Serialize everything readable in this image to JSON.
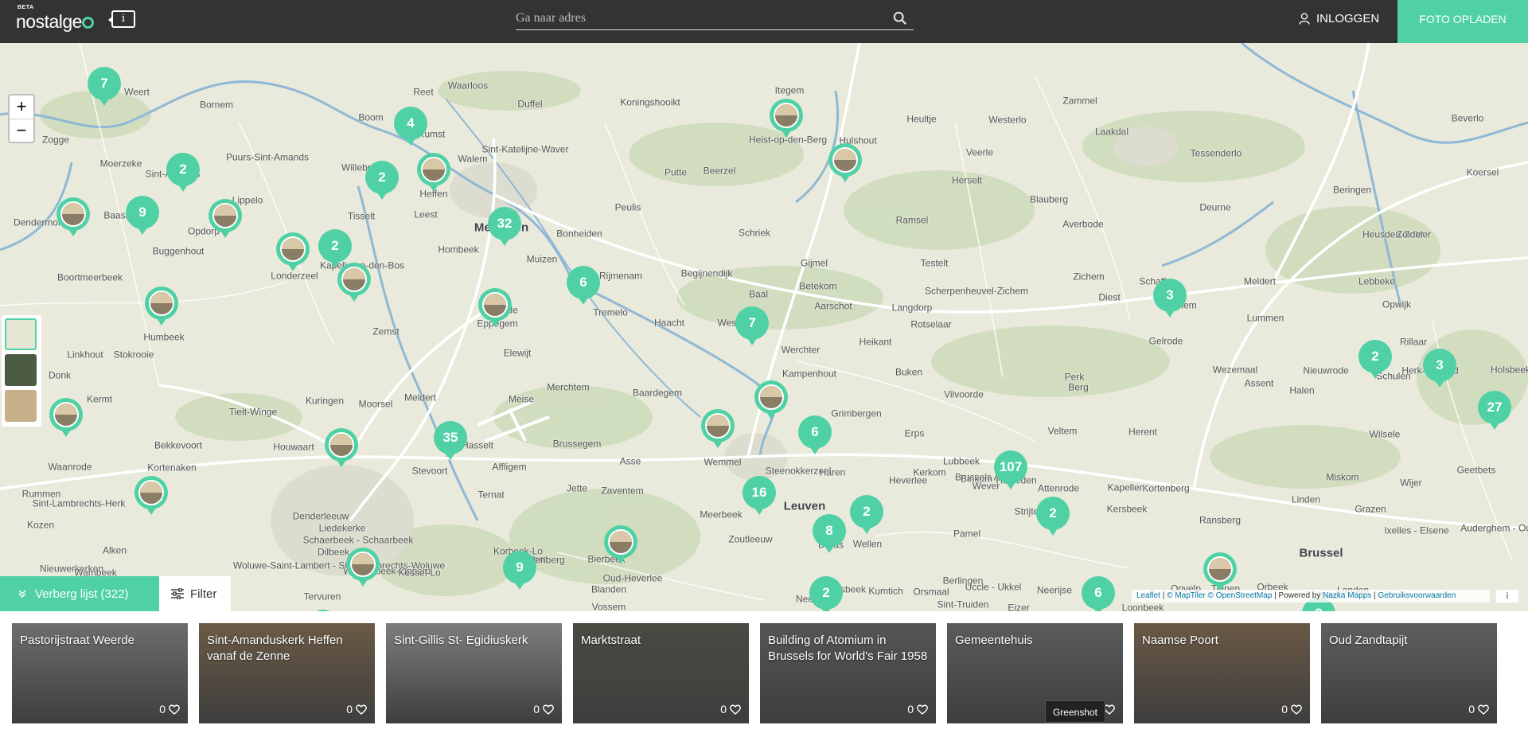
{
  "header": {
    "logo_beta": "BETA",
    "logo_text": "nostalge",
    "info_icon": "info-icon",
    "search_placeholder": "Ga naar adres",
    "login_label": "INLOGGEN",
    "upload_label": "FOTO OPLADEN"
  },
  "map": {
    "zoom_in": "+",
    "zoom_out": "−",
    "places": [
      "Weert",
      "Bornem",
      "Reet",
      "Waarloos",
      "Duffel",
      "Koningshooikt",
      "Itegem",
      "Zammel",
      "Beverlo",
      "Zogge",
      "Puurs-Sint-Amands",
      "Boom",
      "Rumst",
      "Sint-Katelijne-Waver",
      "Heist-op-den-Berg",
      "Hulshout",
      "Heultje",
      "Westerlo",
      "Laakdal",
      "Tessenderlo",
      "Moerzeke",
      "Sint-Amands",
      "Willebroek",
      "Walem",
      "Putte",
      "Beerzel",
      "Veerle",
      "Koersel",
      "Lippelo",
      "Heffen",
      "Herselt",
      "Blauberg",
      "Deurne",
      "Beringen",
      "Dendermonde",
      "Baasrode",
      "Opdorp",
      "Tisselt",
      "Leest",
      "Mechelen",
      "Bonheiden",
      "Peulis",
      "Schriek",
      "Ramsel",
      "Averbode",
      "Heusden-Zolder",
      "Zolder",
      "Buggenhout",
      "Londerzeel",
      "Kapelle-op-den-Bos",
      "Hombeek",
      "Muizen",
      "Rijmenam",
      "Begijnendijk",
      "Gijmel",
      "Testelt",
      "Zichem",
      "Schaffen",
      "Meldert",
      "Lebbeke",
      "Boortmeerbeek",
      "Tremelo",
      "Baal",
      "Betekom",
      "Aarschot",
      "Langdorp",
      "Scherpenheuvel-Zichem",
      "Diest",
      "Zelem",
      "Lummen",
      "Opwijk",
      "Humbeek",
      "Zemst",
      "Weerde",
      "Eppegem",
      "Elewijt",
      "Haacht",
      "Wespelaar",
      "Werchter",
      "Heikant",
      "Rotselaar",
      "Gelrode",
      "Rillaar",
      "Linkhout",
      "Stokrooie",
      "Merchtem",
      "Baardegem",
      "Kampenhout",
      "Buken",
      "Wezemaal",
      "Nieuwrode",
      "Assent",
      "Halen",
      "Schulen",
      "Herk-de-Stad",
      "Donk",
      "Kermt",
      "Kuringen",
      "Moorsel",
      "Meldert",
      "Meise",
      "Grimbergen",
      "Vilvoorde",
      "Perk",
      "Berg",
      "Holsbeek",
      "Tielt-Winge",
      "Bekkevoort",
      "Houwaart",
      "Hasselt",
      "Brussegem",
      "Asse",
      "Wemmel",
      "Steenokkerzeel",
      "Erps",
      "Veltem",
      "Herent",
      "Wilsele",
      "Waanrode",
      "Kortenaken",
      "Stevoort",
      "Affligem",
      "Haren",
      "Brussels Airport",
      "Kortenberg",
      "Linden",
      "Miskom",
      "Wijer",
      "Geetbets",
      "Rummen",
      "Sint-Lambrechts-Herk",
      "Denderleeuw",
      "Ternat",
      "Jette",
      "Zaventem",
      "Meerbeek",
      "Leuven",
      "Lubbeek",
      "Binkom",
      "Attenrode",
      "Kapellen",
      "Kersbeek",
      "Ransberg",
      "Grazen",
      "Kozen",
      "Alken",
      "Liedekerke",
      "Schaerbeek - Schaarbeek",
      "Bertem",
      "Heverlee",
      "Kerkom",
      "Wever",
      "Hoeleden",
      "Nieuwerkerken",
      "Wambeek",
      "Dilbeek",
      "Woluwe-Saint-Lambert - Sint-Lambrechts-Woluwe",
      "Wezembeek-Oppem",
      "Kessel-Lo",
      "Korbeek-Lo",
      "Pellenberg",
      "Bierbeek",
      "Zoutleeuw",
      "Duras",
      "Wellen",
      "Pamel",
      "Strijtem",
      "Brussel",
      "Ixelles - Elsene",
      "Auderghem - Oudergem",
      "Tervuren",
      "Vossem",
      "Oud-Heverlee",
      "Blanden",
      "Neervelp",
      "Roosbeek",
      "Kumtich",
      "Orsmaal",
      "Sint-Truiden",
      "Berlingen",
      "Uccle - Ukkel",
      "Eizer",
      "Neerijse",
      "Loonbeek",
      "Opvelp",
      "Tienen",
      "Orbeek",
      "Bilkel",
      "Landen"
    ],
    "cluster_counts": [
      "7",
      "4",
      "9",
      "2",
      "2",
      "2",
      "32",
      "6",
      "7",
      "3",
      "2",
      "3",
      "27",
      "35",
      "6",
      "107",
      "16",
      "2",
      "2",
      "8",
      "9",
      "2",
      "6",
      "2"
    ],
    "layer_options": [
      "street-map",
      "satellite",
      "historic-map"
    ],
    "list_toggle_label": "Verberg lijst (322)",
    "filter_label": "Filter",
    "attribution": {
      "leaflet": "Leaflet",
      "tiles": "© MapTiler © OpenStreetMap",
      "powered": "Powered by",
      "nazka": "Nazka Mapps",
      "terms": "Gebruiksvoorwaarden"
    },
    "attrib_info": "i"
  },
  "cards": [
    {
      "title": "Pastorijstraat Weerde",
      "likes": "0",
      "color": "#6d6d6d"
    },
    {
      "title": "Sint-Amanduskerk Heffen vanaf de Zenne",
      "likes": "0",
      "color": "#6b5a45"
    },
    {
      "title": "Sint-Gillis St- Egidiuskerk",
      "likes": "0",
      "color": "#7d7d7d"
    },
    {
      "title": "Marktstraat",
      "likes": "0",
      "color": "#4a4a42"
    },
    {
      "title": "Building of Atomium in Brussels for World's Fair 1958",
      "likes": "0",
      "color": "#555555"
    },
    {
      "title": "Gemeentehuis",
      "likes": "0",
      "color": "#5b5b5b"
    },
    {
      "title": "Naamse Poort",
      "likes": "0",
      "color": "#6a5845"
    },
    {
      "title": "Oud Zandtapijt",
      "likes": "0",
      "color": "#5e5e5e"
    }
  ],
  "tooltip": "Greenshot",
  "colors": {
    "accent": "#4fd1a5",
    "header": "#333333"
  }
}
